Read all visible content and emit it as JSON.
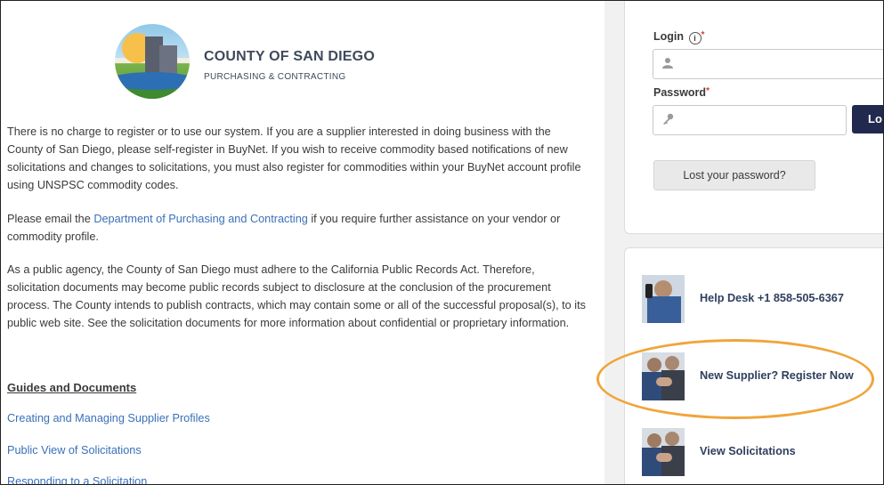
{
  "logo": {
    "title": "COUNTY OF SAN DIEGO",
    "subtitle": "PURCHASING & CONTRACTING"
  },
  "intro": {
    "p1": "There is no charge to register or to use our system. If you are a supplier interested in doing business with the County of San Diego, please self-register in BuyNet. If you wish to receive commodity based notifications of new solicitations and changes to solicitations, you must also register for commodities within your BuyNet account profile using UNSPSC commodity codes.",
    "p2_before": "Please email the ",
    "p2_link": "Department of Purchasing and Contracting",
    "p2_after": " if you require further assistance on your vendor or commodity profile.",
    "p3": "As a public agency, the County of San Diego must adhere to the California Public Records Act. Therefore, solicitation documents may become public records subject to disclosure at the conclusion of the procurement process. The County intends to publish contracts, which may contain some or all of the successful proposal(s), to its public web site. See the solicitation documents for more information about confidential or proprietary information."
  },
  "guides": {
    "heading": "Guides and Documents",
    "links": [
      "Creating and Managing Supplier Profiles",
      "Public View of Solicitations",
      "Responding to a Solicitation"
    ]
  },
  "login": {
    "login_label": "Login",
    "password_label": "Password",
    "required_mark": "*",
    "info_glyph": "i",
    "login_button": "Lo",
    "lost_password_button": "Lost your password?"
  },
  "sidebar": {
    "items": [
      {
        "label": "Help Desk +1 858-505-6367",
        "icon": "help-desk-photo"
      },
      {
        "label": "New Supplier? Register Now",
        "icon": "handshake-photo"
      },
      {
        "label": "View Solicitations",
        "icon": "handshake-photo"
      }
    ]
  },
  "colors": {
    "link": "#3a70b8",
    "login_button_bg": "#21294f",
    "highlight": "#f0a53a",
    "required": "#d23c3c"
  }
}
